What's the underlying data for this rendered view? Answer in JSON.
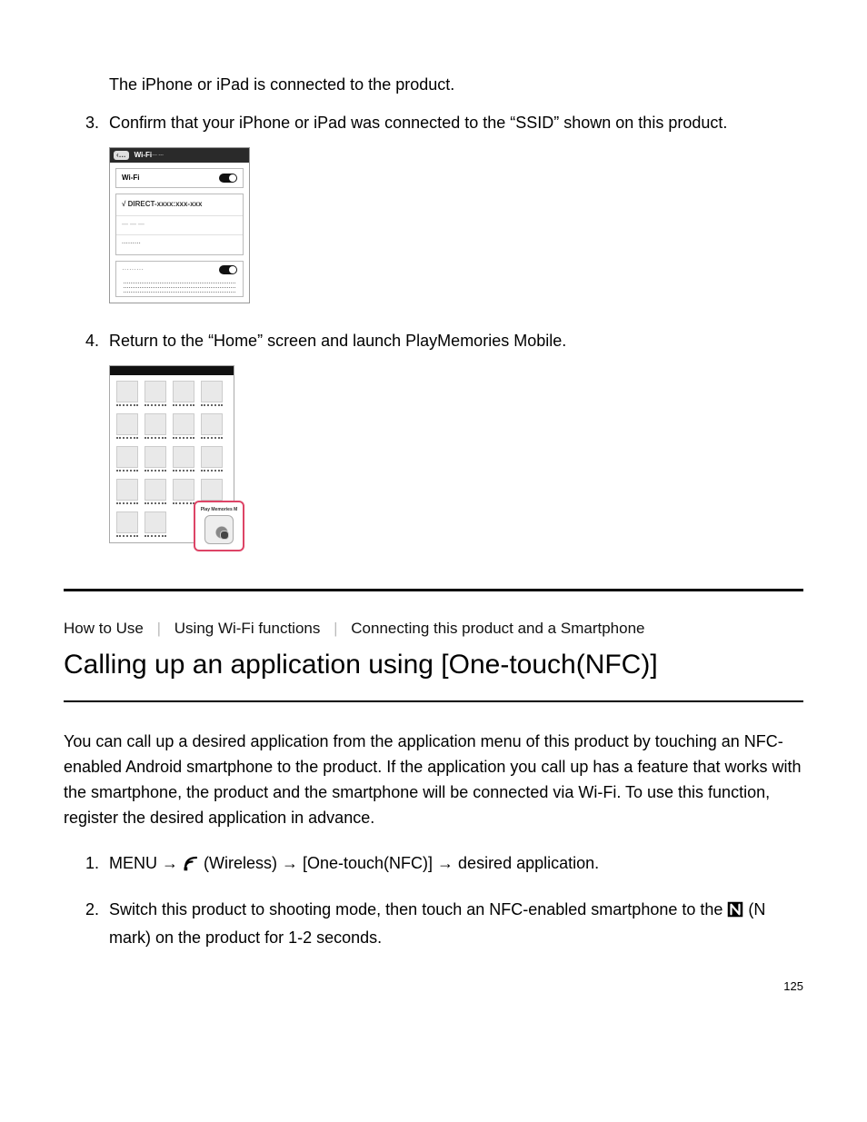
{
  "intro_line": "The iPhone or iPad is connected to the product.",
  "step3": {
    "text": "Confirm that your iPhone or iPad was connected to the “SSID” shown on this product.",
    "fig": {
      "title": "Wi-Fi",
      "wifi_label": "Wi-Fi",
      "ssid": "√ DIRECT-xxxx:xxx-xxx",
      "row2": "— — —",
      "row3": "·········",
      "ask": "·········"
    }
  },
  "step4": {
    "text": "Return to the “Home” screen and launch PlayMemories Mobile.",
    "pm_label": "Play Memories M"
  },
  "breadcrumb": {
    "a": "How to Use",
    "b": "Using Wi-Fi functions",
    "c": "Connecting this product and a Smartphone"
  },
  "title": "Calling up an application using [One-touch(NFC)]",
  "body": "You can call up a desired application from the application menu of this product by touching an NFC-enabled Android smartphone to the product. If the application you call up has a feature that works with the smartphone, the product and the smartphone will be connected via Wi-Fi. To use this function, register the desired application in advance.",
  "nfc_steps": {
    "s1_pre": "MENU → ",
    "s1_mid": "(Wireless) → [One-touch(NFC)] → desired application.",
    "s2_pre": "Switch this product to shooting mode, then touch an NFC-enabled smartphone to the ",
    "s2_post": " (N mark) on the product for 1-2 seconds."
  },
  "page_number": "125"
}
